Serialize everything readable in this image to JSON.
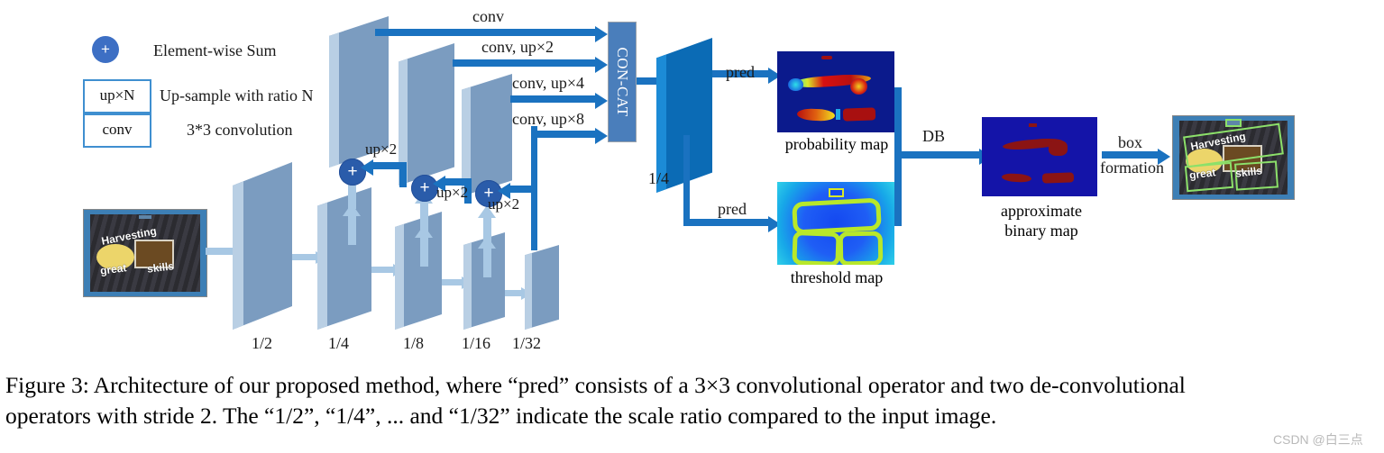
{
  "figure": {
    "caption_line1": "Figure 3: Architecture of our proposed method, where “pred” consists of a 3×3 convolutional operator and two de-convolutional",
    "caption_line2": "operators with stride 2. The “1/2”, “1/4”, ... and “1/32” indicate the scale ratio compared to the input image.",
    "watermark": "CSDN @白三点"
  },
  "legend": {
    "items": [
      {
        "icon": "plus-circle-icon",
        "symbol": "+",
        "label": "Element-wise Sum"
      },
      {
        "icon": "upsample-box-icon",
        "symbol": "up×N",
        "label": "Up-sample with ratio N"
      },
      {
        "icon": "conv-box-icon",
        "symbol": "conv",
        "label": "3*3 convolution"
      }
    ]
  },
  "backbone": {
    "scale_labels": [
      "1/2",
      "1/4",
      "1/8",
      "1/16",
      "1/32"
    ]
  },
  "fusion": {
    "upsample_labels": [
      "up×2",
      "up×2",
      "up×2"
    ],
    "conv_labels": [
      "conv",
      "conv, up×2",
      "conv, up×4",
      "conv, up×8"
    ],
    "concat_label": "CON-CAT",
    "output_scale": "1/4"
  },
  "heads": {
    "pred_top": "pred",
    "pred_bottom": "pred"
  },
  "maps": {
    "probability": "probability map",
    "threshold": "threshold map",
    "binary_line1": "approximate",
    "binary_line2": "binary map"
  },
  "post": {
    "db_label": "DB",
    "box_line1": "box",
    "box_line2": "formation"
  },
  "input_image": {
    "text_top": "Harvesting",
    "text_bottom_left": "great",
    "text_bottom_right": "skills"
  },
  "colors": {
    "slab": "#7b9cc0",
    "slab_edge": "#b9cfe4",
    "output_slab": "#0b6bb5",
    "arrow": "#1a72c0",
    "arrow_light": "#a8c8e4",
    "plus": "#2a5caa",
    "concat": "#4a7ebb",
    "legend_border": "#3f8fd0",
    "box_polygon": "#8ce06a"
  }
}
